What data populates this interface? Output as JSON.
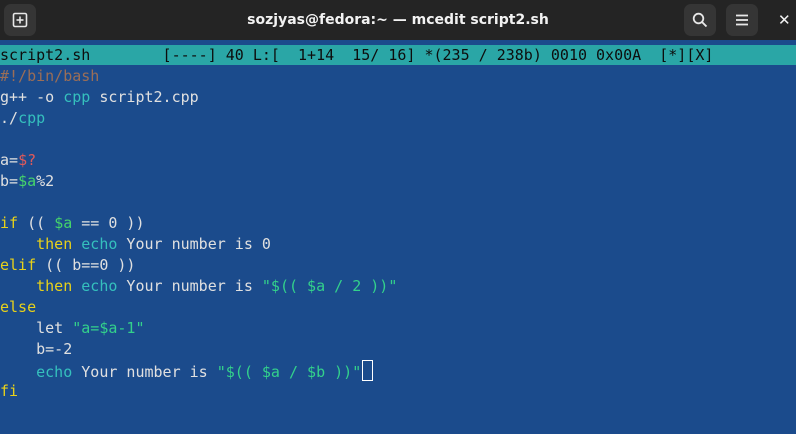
{
  "window": {
    "title": "sozjyas@fedora:~ — mcedit script2.sh",
    "new_tab_icon": "new-tab-icon",
    "search_icon": "search-icon",
    "menu_icon": "hamburger-menu-icon",
    "close_glyph": "✕"
  },
  "status_bar": {
    "text": "script2.sh        [----] 40 L:[  1+14  15/ 16] *(235 / 238b) 0010 0x00A  [*][X]"
  },
  "code_lines": [
    [
      {
        "t": "#!/bin/bash",
        "c": "cmt"
      }
    ],
    [
      {
        "t": "g++ -o ",
        "c": "txt"
      },
      {
        "t": "cpp",
        "c": "cmd"
      },
      {
        "t": " script2.cpp",
        "c": "txt"
      }
    ],
    [
      {
        "t": "./",
        "c": "txt"
      },
      {
        "t": "cpp",
        "c": "cmd"
      }
    ],
    [],
    [
      {
        "t": "a=",
        "c": "txt"
      },
      {
        "t": "$?",
        "c": "spec"
      }
    ],
    [
      {
        "t": "b=",
        "c": "txt"
      },
      {
        "t": "$a",
        "c": "var"
      },
      {
        "t": "%2",
        "c": "txt"
      }
    ],
    [],
    [
      {
        "t": "if",
        "c": "kw"
      },
      {
        "t": " (( ",
        "c": "txt"
      },
      {
        "t": "$a",
        "c": "var"
      },
      {
        "t": " == 0 ))",
        "c": "txt"
      }
    ],
    [
      {
        "t": "    ",
        "c": "txt"
      },
      {
        "t": "then",
        "c": "kw"
      },
      {
        "t": " ",
        "c": "txt"
      },
      {
        "t": "echo",
        "c": "cmd"
      },
      {
        "t": " Your number is 0",
        "c": "txt"
      }
    ],
    [
      {
        "t": "elif",
        "c": "kw"
      },
      {
        "t": " (( b==0 ))",
        "c": "txt"
      }
    ],
    [
      {
        "t": "    ",
        "c": "txt"
      },
      {
        "t": "then",
        "c": "kw"
      },
      {
        "t": " ",
        "c": "txt"
      },
      {
        "t": "echo",
        "c": "cmd"
      },
      {
        "t": " Your number is ",
        "c": "txt"
      },
      {
        "t": "\"$(( $a / 2 ))\"",
        "c": "str"
      }
    ],
    [
      {
        "t": "else",
        "c": "kw"
      }
    ],
    [
      {
        "t": "    let ",
        "c": "txt"
      },
      {
        "t": "\"a=$a-1\"",
        "c": "str"
      }
    ],
    [
      {
        "t": "    b=-2",
        "c": "txt"
      }
    ],
    [
      {
        "t": "    ",
        "c": "txt"
      },
      {
        "t": "echo",
        "c": "cmd"
      },
      {
        "t": " Your number is ",
        "c": "txt"
      },
      {
        "t": "\"$(( $a / $b ))\"",
        "c": "str"
      },
      {
        "t": "",
        "c": "cursor"
      }
    ],
    [
      {
        "t": "fi",
        "c": "kw"
      }
    ]
  ],
  "colors": {
    "background": "#1b4b8c",
    "titlebar": "#242424",
    "status_bar": "#2aa6a6",
    "keyword": "#e7d11a",
    "command": "#35c0bd",
    "variable": "#45d46b",
    "string": "#33d18b",
    "comment": "#9b6e57"
  }
}
